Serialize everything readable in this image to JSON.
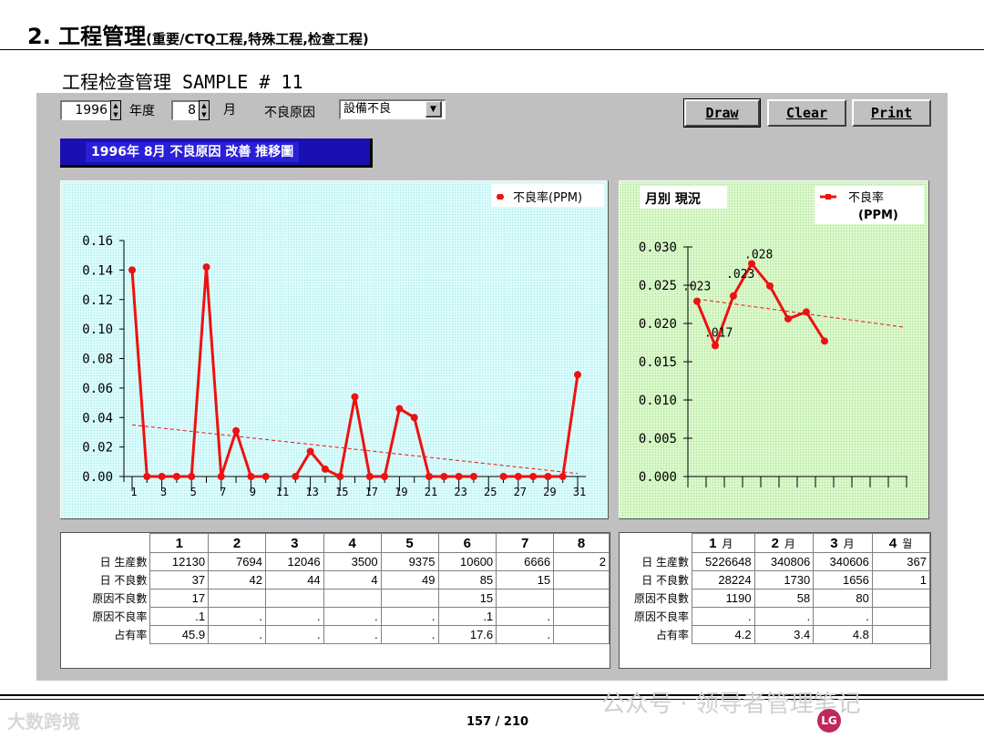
{
  "header": {
    "title": "2.  工程管理",
    "subtitle": "(重要/CTQ工程,特殊工程,检查工程)"
  },
  "window": {
    "title": "工程检查管理   SAMPLE #  11"
  },
  "toolbar": {
    "year_value": "1996",
    "year_label": "年度",
    "month_value": "8",
    "month_label": "月",
    "cause_label": "不良原因",
    "cause_value": "設備不良",
    "draw_label": "Draw",
    "clear_label": "Clear",
    "print_label": "Print"
  },
  "banner": {
    "text": "1996年 8月 不良原因 改善 推移圖"
  },
  "colors": {
    "daily_bg": "#ccf5f5",
    "monthly_bg": "#d2f5c2",
    "series": "#ee1111",
    "banner": "#1a0fb0",
    "panel": "#c0c0c0"
  },
  "chart_data": [
    {
      "type": "line",
      "legend": "不良率(PPM)",
      "legend_position": "top-right",
      "x": [
        1,
        2,
        3,
        4,
        5,
        6,
        7,
        8,
        9,
        10,
        11,
        12,
        13,
        14,
        15,
        16,
        17,
        18,
        19,
        20,
        21,
        22,
        23,
        24,
        25,
        26,
        27,
        28,
        29,
        30,
        31
      ],
      "x_tick_labels": [
        "1",
        "3",
        "5",
        "7",
        "9",
        "11",
        "13",
        "15",
        "17",
        "19",
        "21",
        "23",
        "25",
        "27",
        "29",
        "31"
      ],
      "series": [
        {
          "values": [
            0.14,
            0,
            0,
            0,
            0,
            0.142,
            0,
            0.031,
            0,
            0,
            null,
            0,
            0.017,
            0.005,
            0,
            0.054,
            0,
            0,
            0.046,
            0.04,
            0,
            0,
            0,
            0,
            null,
            0,
            0,
            0,
            0,
            0,
            0.069
          ]
        }
      ],
      "trendline": [
        0.035,
        0.002
      ],
      "ylim": [
        0,
        0.16
      ],
      "y_ticks": [
        "0.00",
        "0.02",
        "0.04",
        "0.06",
        "0.08",
        "0.10",
        "0.12",
        "0.14",
        "0.16"
      ],
      "grid": false
    },
    {
      "type": "line",
      "title": "月別 現況",
      "legend": "不良率\n(PPM)",
      "legend_position": "top-right",
      "x": [
        1,
        2,
        3,
        4,
        5,
        6,
        7,
        8
      ],
      "series": [
        {
          "values": [
            0.0229,
            0.0171,
            0.0236,
            0.0278,
            0.0249,
            0.0206,
            0.0215,
            0.0177
          ]
        }
      ],
      "data_labels": [
        ".023",
        ".017",
        ".023",
        ".028"
      ],
      "trendline": [
        0.0232,
        0.0195
      ],
      "ylim": [
        0,
        0.03
      ],
      "y_ticks": [
        "0.000",
        "0.005",
        "0.010",
        "0.015",
        "0.020",
        "0.025",
        "0.030"
      ],
      "grid": false
    }
  ],
  "daily_table": {
    "columns": [
      "1",
      "2",
      "3",
      "4",
      "5",
      "6",
      "7",
      "8"
    ],
    "rows": [
      {
        "label": "日 生産數",
        "cells": [
          "12130",
          "7694",
          "12046",
          "3500",
          "9375",
          "10600",
          "6666",
          "2"
        ]
      },
      {
        "label": "日 不良數",
        "cells": [
          "37",
          "42",
          "44",
          "4",
          "49",
          "85",
          "15",
          ""
        ]
      },
      {
        "label": "原因不良數",
        "cells": [
          "17",
          "",
          "",
          "",
          "",
          "15",
          "",
          ""
        ]
      },
      {
        "label": "原因不良率",
        "cells": [
          ".1",
          ".",
          ".",
          ".",
          ".",
          ".1",
          ".",
          ""
        ]
      },
      {
        "label": "占有率",
        "cells": [
          "45.9",
          ".",
          ".",
          ".",
          ".",
          "17.6",
          ".",
          ""
        ]
      }
    ]
  },
  "monthly_table": {
    "columns": [
      "1",
      "2",
      "3",
      "4"
    ],
    "column_suffixes": [
      "月",
      "月",
      "月",
      "월"
    ],
    "rows": [
      {
        "label": "日 生産數",
        "cells": [
          "5226648",
          "340806",
          "340606",
          "367"
        ]
      },
      {
        "label": "日 不良數",
        "cells": [
          "28224",
          "1730",
          "1656",
          "1"
        ]
      },
      {
        "label": "原因不良數",
        "cells": [
          "1190",
          "58",
          "80",
          ""
        ]
      },
      {
        "label": "原因不良率",
        "cells": [
          ".",
          ".",
          ".",
          ""
        ]
      },
      {
        "label": "占有率",
        "cells": [
          "4.2",
          "3.4",
          "4.8",
          ""
        ]
      }
    ]
  },
  "footer": {
    "page_number": "157 / 210",
    "watermark_left": "大数跨境",
    "watermark_right": "公众号 · 领导者管理笔记",
    "logo_text": "LG"
  }
}
